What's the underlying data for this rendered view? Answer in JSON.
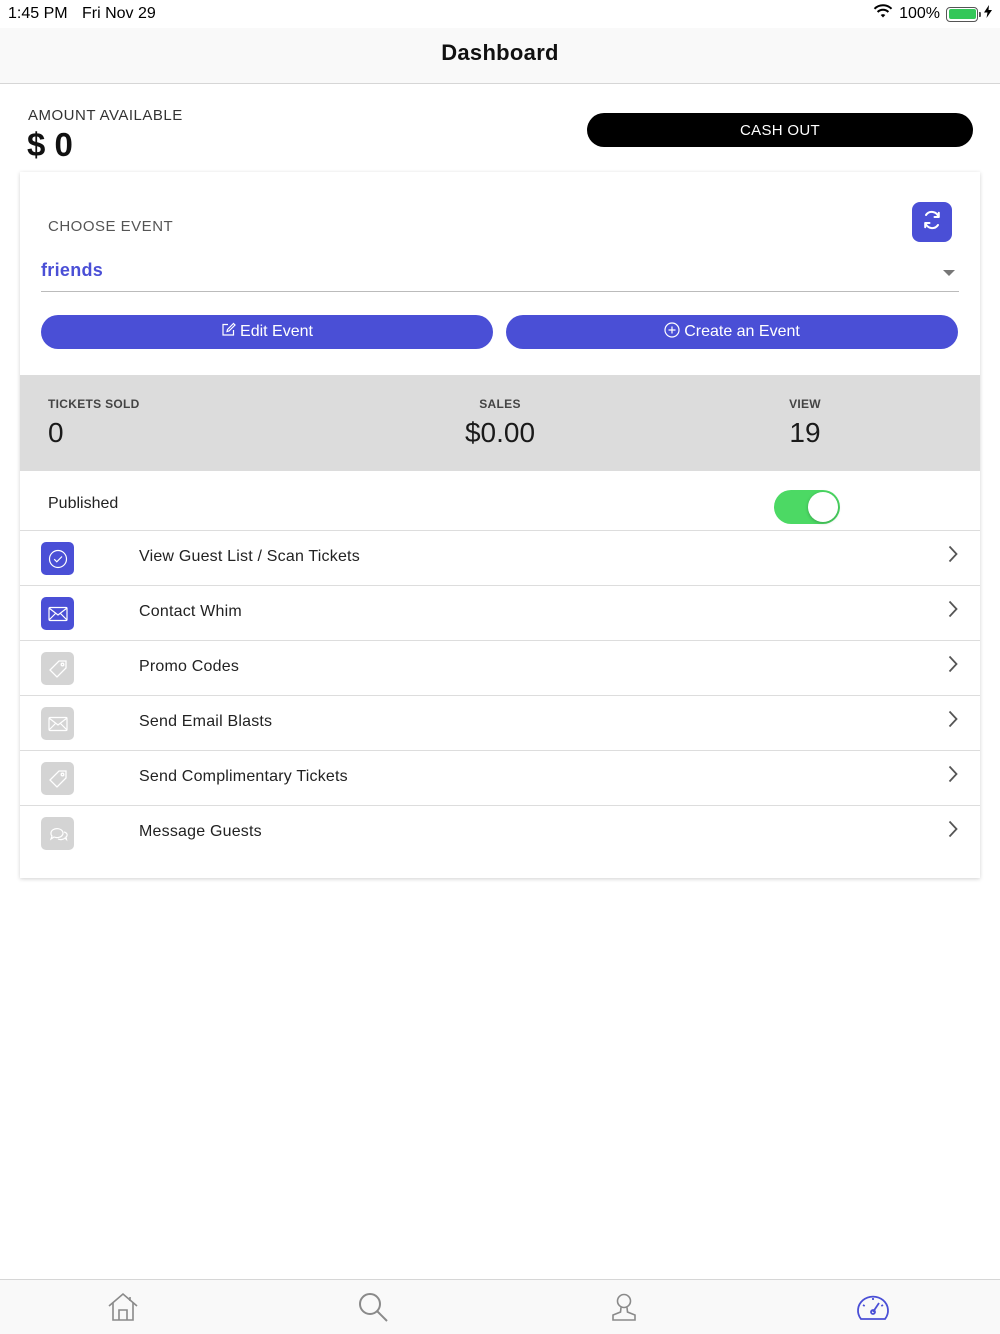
{
  "status_bar": {
    "time": "1:45 PM",
    "date": "Fri Nov 29",
    "battery": "100%"
  },
  "nav": {
    "title": "Dashboard"
  },
  "amount": {
    "label": "AMOUNT AVAILABLE",
    "value": "$ 0",
    "cashout_label": "CASH OUT"
  },
  "event": {
    "choose_label": "CHOOSE EVENT",
    "selected": "friends",
    "edit_label": "Edit Event",
    "create_label": "Create an Event"
  },
  "stats": {
    "tickets_sold": {
      "label": "TICKETS SOLD",
      "value": "0"
    },
    "sales": {
      "label": "SALES",
      "value": "$0.00"
    },
    "view": {
      "label": "VIEW",
      "value": "19"
    }
  },
  "published": {
    "label": "Published",
    "on": true
  },
  "menu": [
    {
      "label": "View Guest List / Scan Tickets",
      "icon": "check-circle-icon",
      "active": true
    },
    {
      "label": "Contact Whim",
      "icon": "envelope-icon",
      "active": true
    },
    {
      "label": "Promo Codes",
      "icon": "tag-icon",
      "active": false
    },
    {
      "label": "Send Email Blasts",
      "icon": "envelope-icon",
      "active": false
    },
    {
      "label": "Send Complimentary Tickets",
      "icon": "tag-icon",
      "active": false
    },
    {
      "label": "Message Guests",
      "icon": "chat-bubbles-icon",
      "active": false
    }
  ],
  "tabs": [
    "home-icon",
    "search-icon",
    "profile-icon",
    "dashboard-gauge-icon"
  ],
  "colors": {
    "accent": "#4a4fd6",
    "toggle_on": "#4cd964",
    "inactive_icon": "#d4d4d4"
  }
}
